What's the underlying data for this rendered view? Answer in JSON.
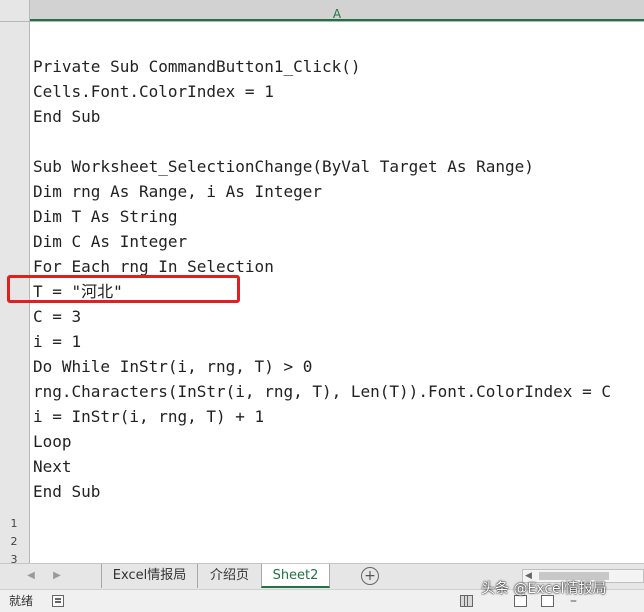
{
  "spreadsheet": {
    "column_header": "A",
    "row_numbers": [
      "1",
      "2",
      "3"
    ],
    "code_lines": [
      "Private Sub CommandButton1_Click()",
      "Cells.Font.ColorIndex = 1",
      "End Sub",
      "",
      "Sub Worksheet_SelectionChange(ByVal Target As Range)",
      "Dim rng As Range, i As Integer",
      "Dim T As String",
      "Dim C As Integer",
      "For Each rng In Selection",
      "T = \"河北\"",
      "C = 3",
      "i = 1",
      "Do While InStr(i, rng, T) > 0",
      "rng.Characters(InStr(i, rng, T), Len(T)).Font.ColorIndex = C",
      "i = InStr(i, rng, T) + 1",
      "Loop",
      "Next",
      "End Sub"
    ],
    "highlight_color": "#e02020"
  },
  "tabs": {
    "prev_icon": "chevron-left-icon",
    "next_icon": "chevron-right-icon",
    "items": [
      {
        "label": "Excel情报局",
        "active": false
      },
      {
        "label": "介绍页",
        "active": false
      },
      {
        "label": "Sheet2",
        "active": true
      }
    ],
    "add_icon": "plus-circle-icon",
    "add_label": "+"
  },
  "status": {
    "ready_text": "就绪",
    "zoom_minus": "–"
  },
  "watermark": "头条 @Excel情报局",
  "colors": {
    "accent": "#217346"
  }
}
